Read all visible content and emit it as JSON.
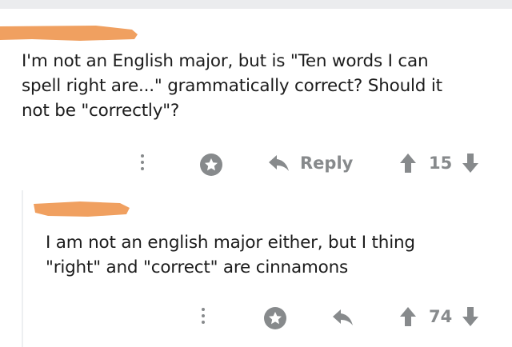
{
  "comments": [
    {
      "body": [
        "I'm not an English major, but is \"Ten words I can",
        "spell right are...\" grammatically correct? Should it",
        "not be \"correctly\"?"
      ],
      "actions": {
        "reply_label": "Reply",
        "vote_count": "15"
      }
    },
    {
      "body": [
        "I am not an english major either, but I thing",
        "\"right\" and \"correct\" are cinnamons"
      ],
      "actions": {
        "vote_count": "74"
      }
    }
  ],
  "colors": {
    "redaction": "#f0a060",
    "icon_gray": "#878a8c",
    "text": "#1c1c1c"
  }
}
